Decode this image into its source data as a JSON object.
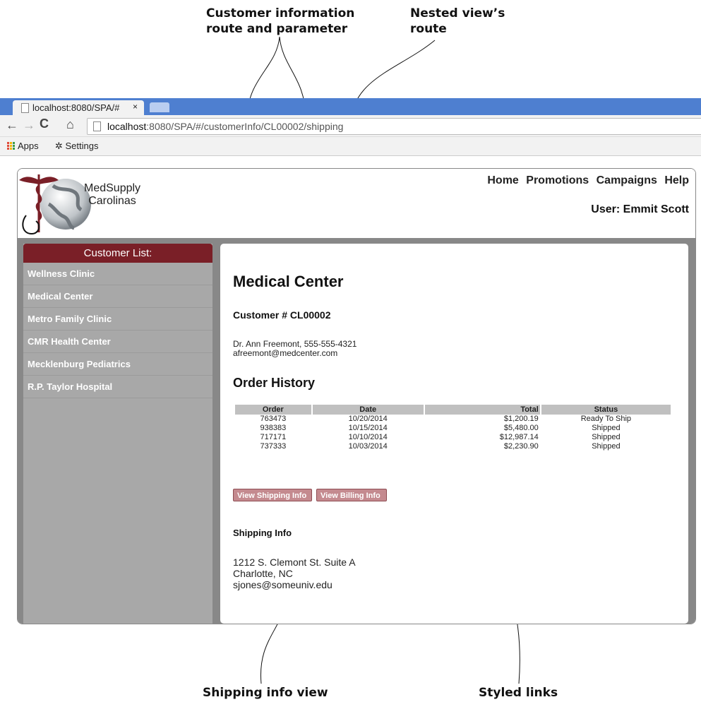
{
  "annotations": {
    "route_param": [
      "Customer information",
      "route and parameter"
    ],
    "nested_route": [
      "Nested view’s",
      "route"
    ],
    "shipping_view": "Shipping info view",
    "styled_links": "Styled links"
  },
  "browser": {
    "tab_title": "localhost:8080/SPA/#",
    "tab_close": "×",
    "url_host": "localhost",
    "url_path": ":8080/SPA/#/customerInfo/CL00002/shipping",
    "bookmarks": [
      "Apps",
      "Settings"
    ]
  },
  "app": {
    "brand": [
      "MedSupply",
      "Carolinas"
    ],
    "nav": [
      "Home",
      "Promotions",
      "Campaigns",
      "Help"
    ],
    "user": "User: Emmit Scott",
    "sidebar": {
      "title": "Customer List:",
      "items": [
        "Wellness Clinic",
        "Medical Center",
        "Metro Family Clinic",
        "CMR Health Center",
        "Mecklenburg Pediatrics",
        "R.P. Taylor Hospital"
      ]
    },
    "customer": {
      "name": "Medical Center",
      "number": "Customer # CL00002",
      "contact": "Dr. Ann Freemont, 555-555-4321",
      "email": "afreemont@medcenter.com"
    },
    "orders": {
      "heading": "Order History",
      "columns": [
        "Order",
        "Date",
        "Total",
        "Status"
      ],
      "rows": [
        [
          "763473",
          "10/20/2014",
          "$1,200.19",
          "Ready To Ship"
        ],
        [
          "938383",
          "10/15/2014",
          "$5,480.00",
          "Shipped"
        ],
        [
          "717171",
          "10/10/2014",
          "$12,987.14",
          "Shipped"
        ],
        [
          "737333",
          "10/03/2014",
          "$2,230.90",
          "Shipped"
        ]
      ]
    },
    "buttons": {
      "shipping": "View Shipping Info",
      "billing": "View Billing Info"
    },
    "shipping": {
      "heading": "Shipping Info",
      "lines": [
        "1212 S. Clemont St. Suite A",
        "Charlotte, NC",
        "sjones@someuniv.edu"
      ]
    },
    "colors": {
      "accent": "#7a1f27",
      "sidebar": "#a8a8a8",
      "button": "#c48a8f",
      "browser_blue": "#4e7fd0"
    }
  }
}
